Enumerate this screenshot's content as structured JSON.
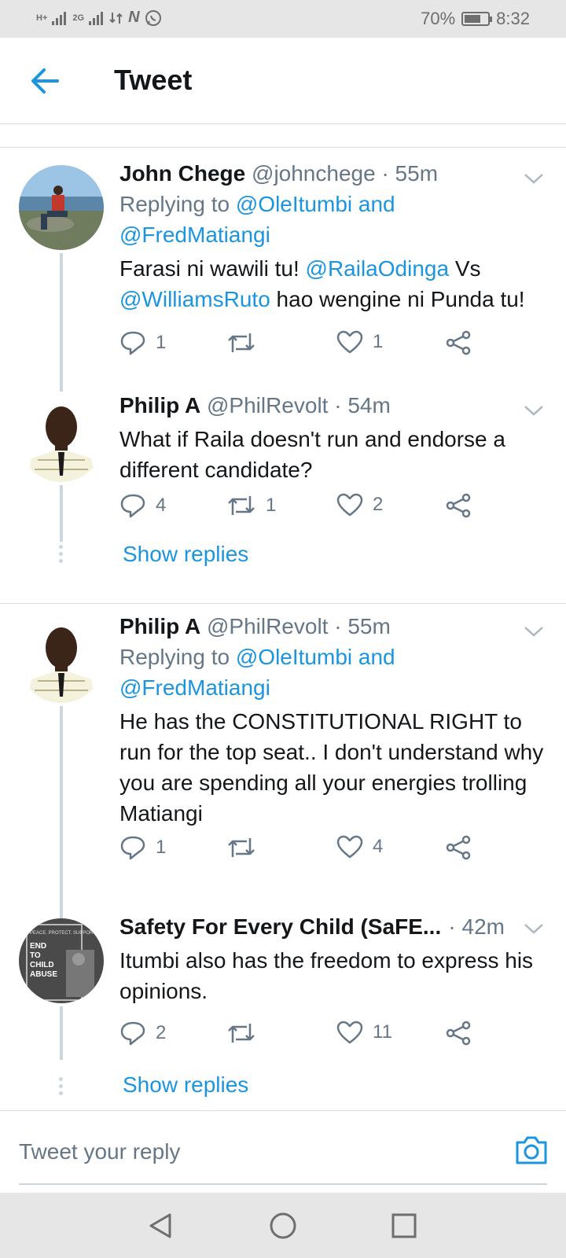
{
  "status_bar": {
    "network_1": "H+",
    "network_2": "2G",
    "app_icon": "N",
    "battery_percent": "70%",
    "battery_level": 0.7,
    "time": "8:32"
  },
  "header": {
    "title": "Tweet"
  },
  "tweets": [
    {
      "name": "John Chege",
      "handle": "@johnchege",
      "time": "· 55m",
      "replying_label": "Replying to",
      "replying_to": [
        "@OleItumbi",
        "@FredMatiangi"
      ],
      "replying_and": "and",
      "body_parts": [
        "Farasi ni wawili tu! ",
        "@RailaOdinga",
        " Vs ",
        "@WilliamsRuto",
        " hao wengine ni Punda tu!"
      ],
      "replies": "1",
      "retweets": "",
      "likes": "1"
    },
    {
      "name": "Philip A",
      "handle": "@PhilRevolt",
      "time": "· 54m",
      "body": "What if Raila doesn't run and endorse a different candidate?",
      "replies": "4",
      "retweets": "1",
      "likes": "2",
      "show_replies": "Show replies"
    },
    {
      "name": "Philip A",
      "handle": "@PhilRevolt",
      "time": "· 55m",
      "replying_label": "Replying to",
      "replying_to": [
        "@OleItumbi",
        "@FredMatiangi"
      ],
      "replying_and": "and",
      "body": "He has the CONSTITUTIONAL RIGHT to run for the top seat.. I don't understand why you are spending all your energies trolling Matiangi",
      "replies": "1",
      "retweets": "",
      "likes": "4"
    },
    {
      "name": "Safety For Every Child (SaFE...",
      "handle": "",
      "time": "· 42m",
      "body": "Itumbi also has the freedom to express his opinions.",
      "replies": "2",
      "retweets": "",
      "likes": "11",
      "show_replies": "Show replies",
      "avatar_text": [
        "PEACE. PROTECT. SUPPORT.",
        "END",
        "TO",
        "CHILD",
        "ABUSE"
      ]
    }
  ],
  "compose": {
    "placeholder": "Tweet your reply"
  },
  "colors": {
    "accent": "#1b95e0",
    "secondary_text": "#657786",
    "status_bar_bg": "#e6e6e6"
  }
}
